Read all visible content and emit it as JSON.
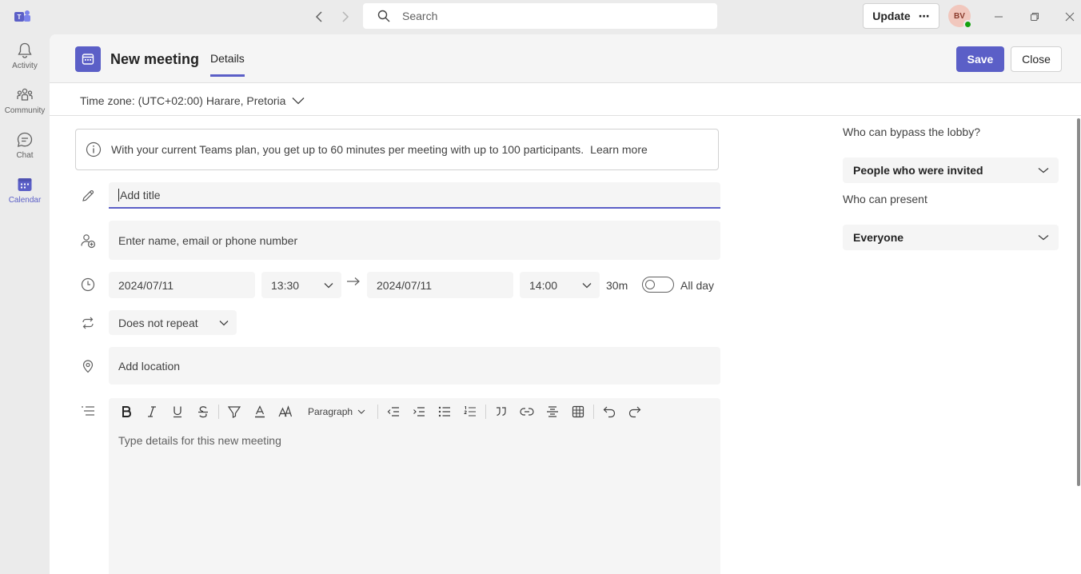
{
  "titlebar": {
    "search_placeholder": "Search",
    "update_label": "Update",
    "update_more": "⋯",
    "avatar_initials": "BV"
  },
  "rail": {
    "items": [
      {
        "label": "Activity",
        "icon": "bell-icon"
      },
      {
        "label": "Community",
        "icon": "community-icon"
      },
      {
        "label": "Chat",
        "icon": "chat-icon"
      },
      {
        "label": "Calendar",
        "icon": "calendar-icon",
        "active": true
      }
    ]
  },
  "header": {
    "title": "New meeting",
    "tab": "Details",
    "save_label": "Save",
    "close_label": "Close"
  },
  "timezone": "Time zone: (UTC+02:00) Harare, Pretoria",
  "notice": {
    "text": "With your current Teams plan, you get up to 60 minutes per meeting with up to 100 participants.",
    "link": "Learn more"
  },
  "form": {
    "title_placeholder": "Add title",
    "attendees_placeholder": "Enter name, email or phone number",
    "start_date": "2024/07/11",
    "start_time": "13:30",
    "end_date": "2024/07/11",
    "end_time": "14:00",
    "duration": "30m",
    "all_day_label": "All day",
    "repeat": "Does not repeat",
    "location_placeholder": "Add location",
    "details_placeholder": "Type details for this new meeting",
    "paragraph_label": "Paragraph"
  },
  "options": {
    "bypass_label": "Who can bypass the lobby?",
    "bypass_value": "People who were invited",
    "present_label": "Who can present",
    "present_value": "Everyone"
  },
  "colors": {
    "accent": "#5b5fc7",
    "status_available": "#13a10e"
  }
}
